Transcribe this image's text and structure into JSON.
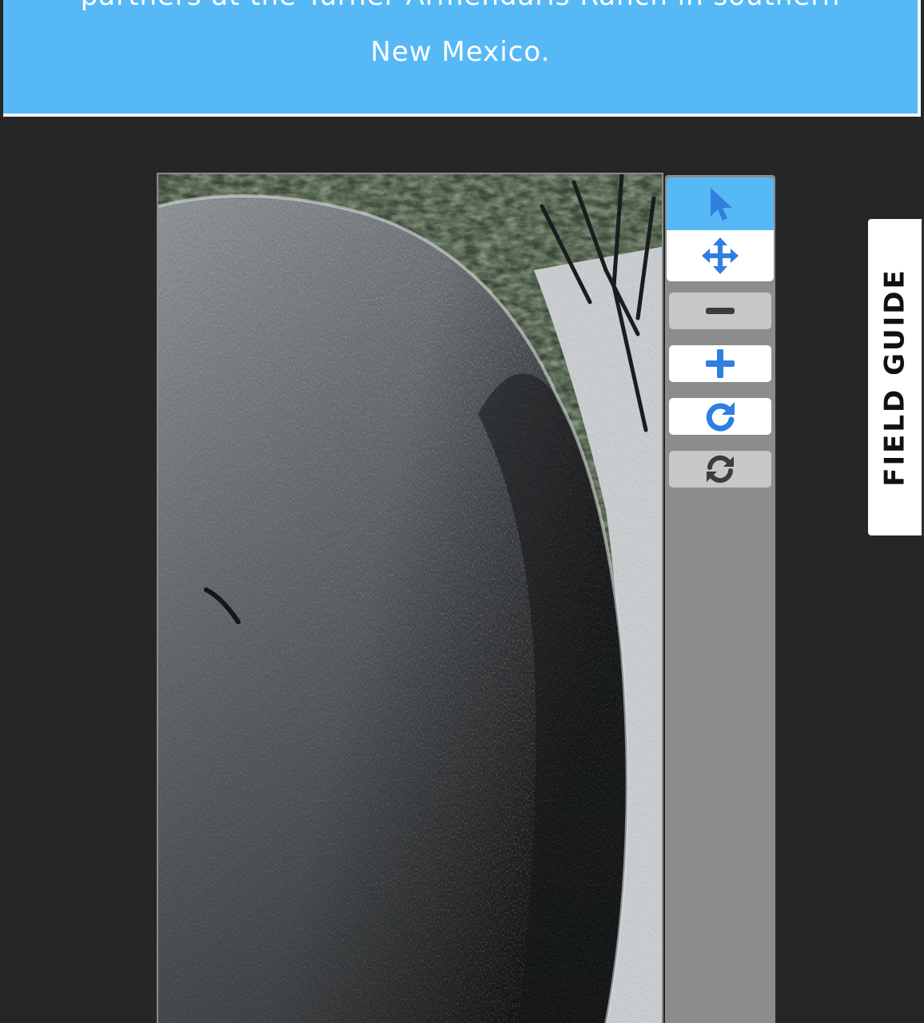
{
  "banner": {
    "text_line1": "partners at the Turner Armendaris Ranch in southern",
    "text_line2": "New Mexico."
  },
  "subject": {
    "image_description": "camera-trap-photo"
  },
  "toolbar": {
    "tools": [
      {
        "icon": "pointer-icon",
        "state": "active"
      },
      {
        "icon": "move-icon",
        "state": "enabled"
      },
      {
        "icon": "zoom-out-icon",
        "state": "disabled"
      },
      {
        "icon": "zoom-in-icon",
        "state": "enabled"
      },
      {
        "icon": "rotate-icon",
        "state": "enabled"
      },
      {
        "icon": "reset-icon",
        "state": "disabled"
      }
    ],
    "colors": {
      "accent": "#56b9f6",
      "icon_blue": "#2f7fe0",
      "icon_disabled": "#3c3c3c"
    }
  },
  "field_guide": {
    "label": "FIELD GUIDE"
  }
}
